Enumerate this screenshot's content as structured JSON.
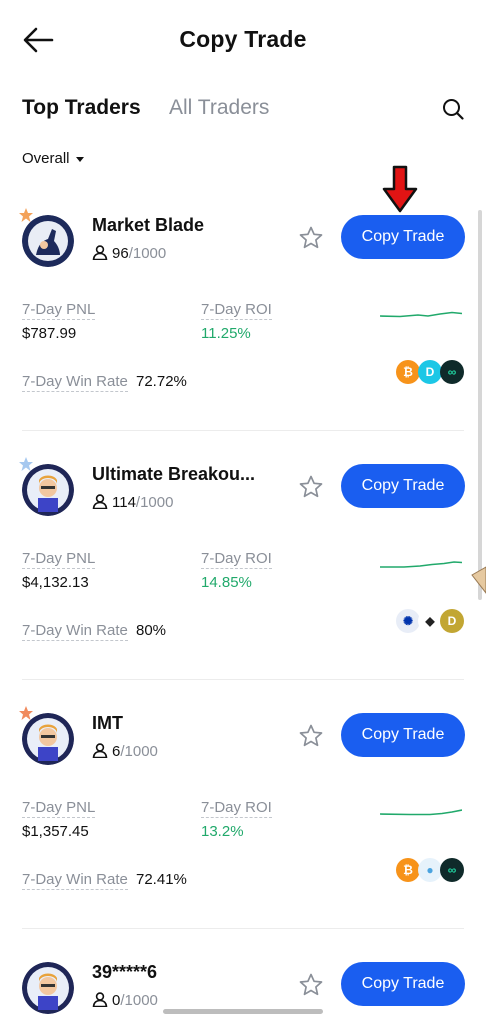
{
  "header": {
    "title": "Copy Trade"
  },
  "tabs": [
    {
      "label": "Top Traders"
    },
    {
      "label": "All Traders"
    }
  ],
  "filter": {
    "label": "Overall"
  },
  "labels": {
    "pnl": "7-Day PNL",
    "roi": "7-Day ROI",
    "winrate": "7-Day Win Rate"
  },
  "traders": [
    {
      "name": "Market Blade",
      "followers": "96",
      "max_followers": "/1000",
      "button": "Copy Trade",
      "pnl": "$787.99",
      "roi": "11.25%",
      "win_rate": "72.72%",
      "coins": [
        "bitcoin-icon",
        "dash-icon",
        "chain-icon"
      ]
    },
    {
      "name": "Ultimate Breakou...",
      "followers": "114",
      "max_followers": "/1000",
      "button": "Copy Trade",
      "pnl": "$4,132.13",
      "roi": "14.85%",
      "win_rate": "80%",
      "coins": [
        "cardano-icon",
        "ethereum-icon",
        "dogecoin-icon"
      ]
    },
    {
      "name": "IMT",
      "followers": "6",
      "max_followers": "/1000",
      "button": "Copy Trade",
      "pnl": "$1,357.45",
      "roi": "13.2%",
      "win_rate": "72.41%",
      "coins": [
        "bitcoin-icon",
        "water-drop-icon",
        "chain-icon"
      ]
    },
    {
      "name": "39*****6",
      "followers": "0",
      "max_followers": "/1000",
      "button": "Copy Trade"
    }
  ],
  "colors": {
    "accent": "#1a5ef0",
    "positive": "#21a96b",
    "annotation_arrow": "#e11414"
  }
}
